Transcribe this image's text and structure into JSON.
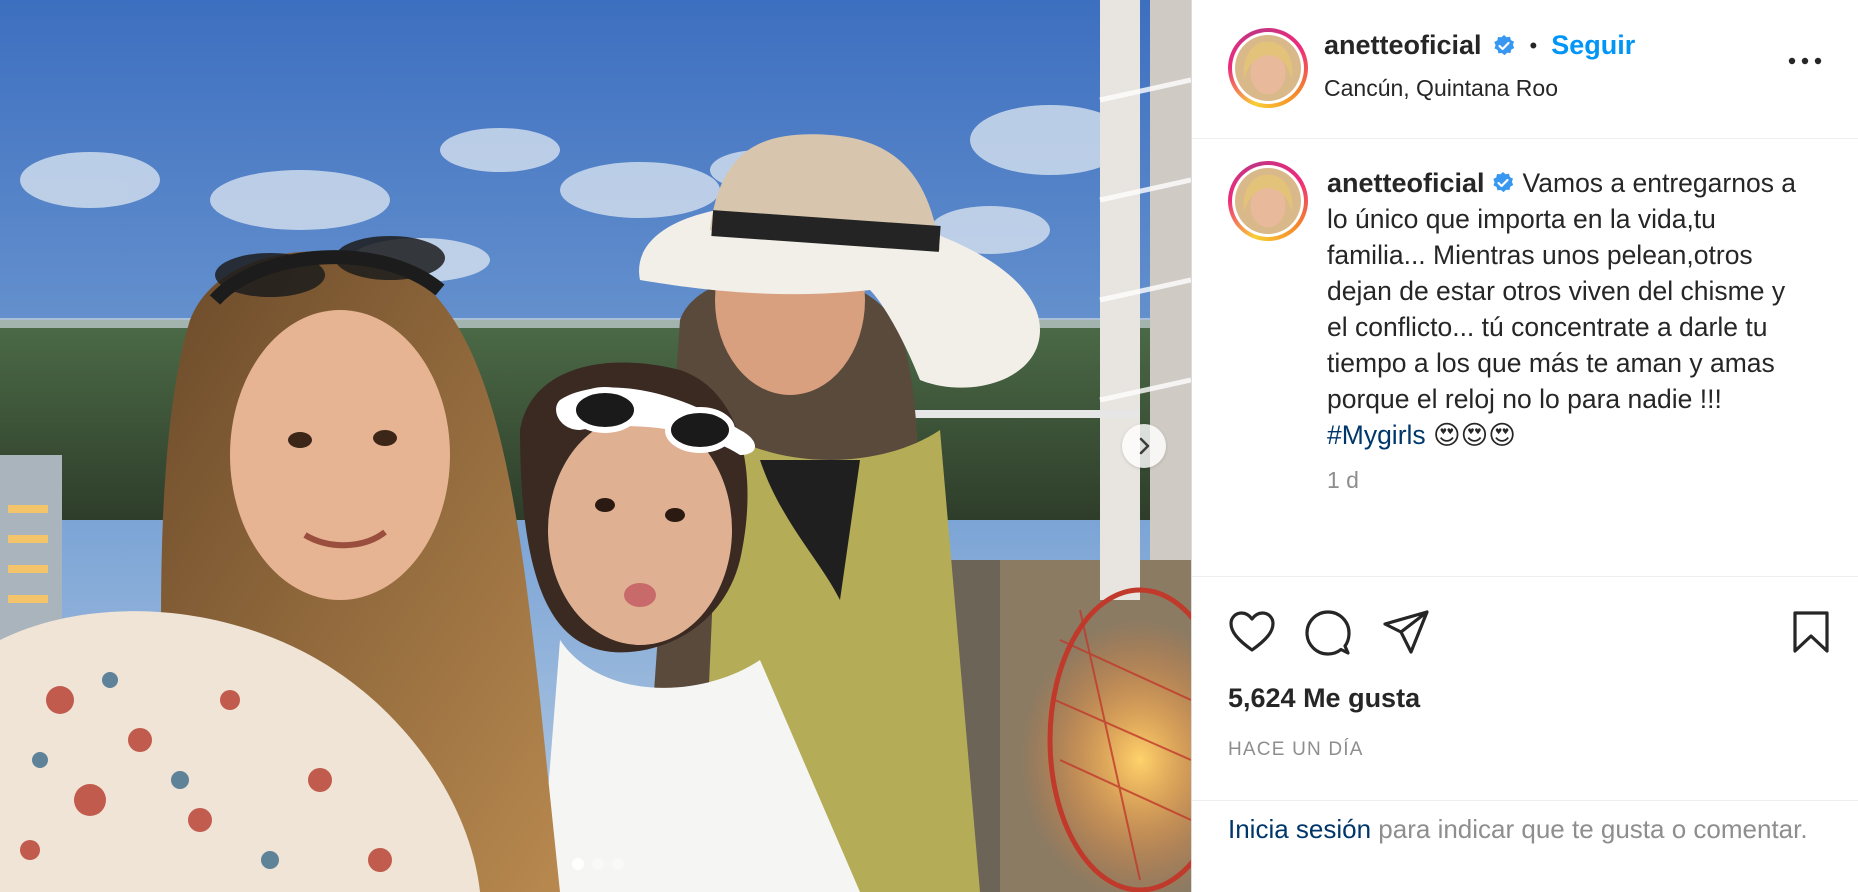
{
  "post": {
    "username": "anetteoficial",
    "verified_icon": "verified-badge-icon",
    "separator": "•",
    "follow_label": "Seguir",
    "location": "Cancún, Quintana Roo",
    "caption_text": "Vamos a entregarnos a lo único que importa en la vida,tu familia... Mientras unos pelean,otros dejan de estar otros viven del chisme y el conflicto... tú concentrate a darle tu tiempo a los que más te aman y amas porque el reloj no lo para nadie !!! ",
    "hashtag": "#Mygirls",
    "emoji_tail": " 😍😍😍",
    "relative_time": "1 d",
    "likes": "5,624 Me gusta",
    "date_caps": "HACE UN DÍA",
    "carousel": {
      "current": 1,
      "total": 3
    }
  },
  "footer": {
    "login_link": "Inicia sesión",
    "login_text": " para indicar que te gusta o comentar."
  },
  "colors": {
    "accent": "#0095f6",
    "hashtag": "#00376b",
    "verified": "#3897f0",
    "muted": "#8e8e8e"
  }
}
